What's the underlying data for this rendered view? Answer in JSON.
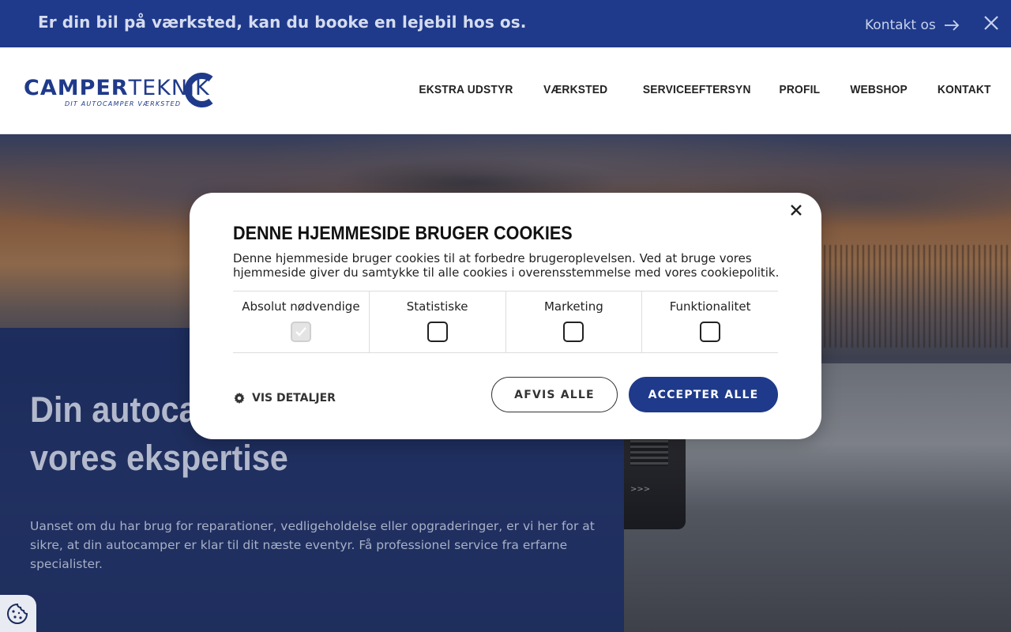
{
  "topbar": {
    "message": "Er din bil på værksted, kan du booke en lejebil hos os.",
    "contact_label": "Kontakt os",
    "close_icon": "close-icon",
    "color": "#1f3a8a"
  },
  "header": {
    "logo": {
      "word_part1": "CAMPER",
      "word_part2": "TEKNIK",
      "tagline": "DIT AUTOCAMPER VÆRKSTED"
    },
    "nav": [
      "EKSTRA UDSTYR",
      "VÆRKSTED",
      "SERVICEEFTERSYN",
      "PROFIL",
      "WEBSHOP",
      "KONTAKT"
    ]
  },
  "hero": {
    "heading_line1": "Din autoca",
    "heading_line2": "vores ekspertise",
    "text": "Uanset om du har brug for reparationer, vedligeholdelse eller opgraderinger, er vi her for at sikre, at din autocamper er klar til dit næste eventyr. Få professionel service fra erfarne specialister.",
    "van_badge": ">>>"
  },
  "cookie": {
    "title": "DENNE HJEMMESIDE BRUGER COOKIES",
    "description": "Denne hjemmeside bruger cookies til at forbedre brugeroplevelsen. Ved at bruge vores hjemmeside giver du samtykke til alle cookies i overensstemmelse med vores cookiepolitik.",
    "categories": [
      {
        "label": "Absolut nødvendige",
        "checked": true,
        "disabled": true
      },
      {
        "label": "Statistiske",
        "checked": false
      },
      {
        "label": "Marketing",
        "checked": false
      },
      {
        "label": "Funktionalitet",
        "checked": false
      }
    ],
    "details_label": "VIS DETALJER",
    "reject_label": "AFVIS ALLE",
    "accept_label": "ACCEPTER ALLE",
    "accent": "#1f3a8a"
  }
}
